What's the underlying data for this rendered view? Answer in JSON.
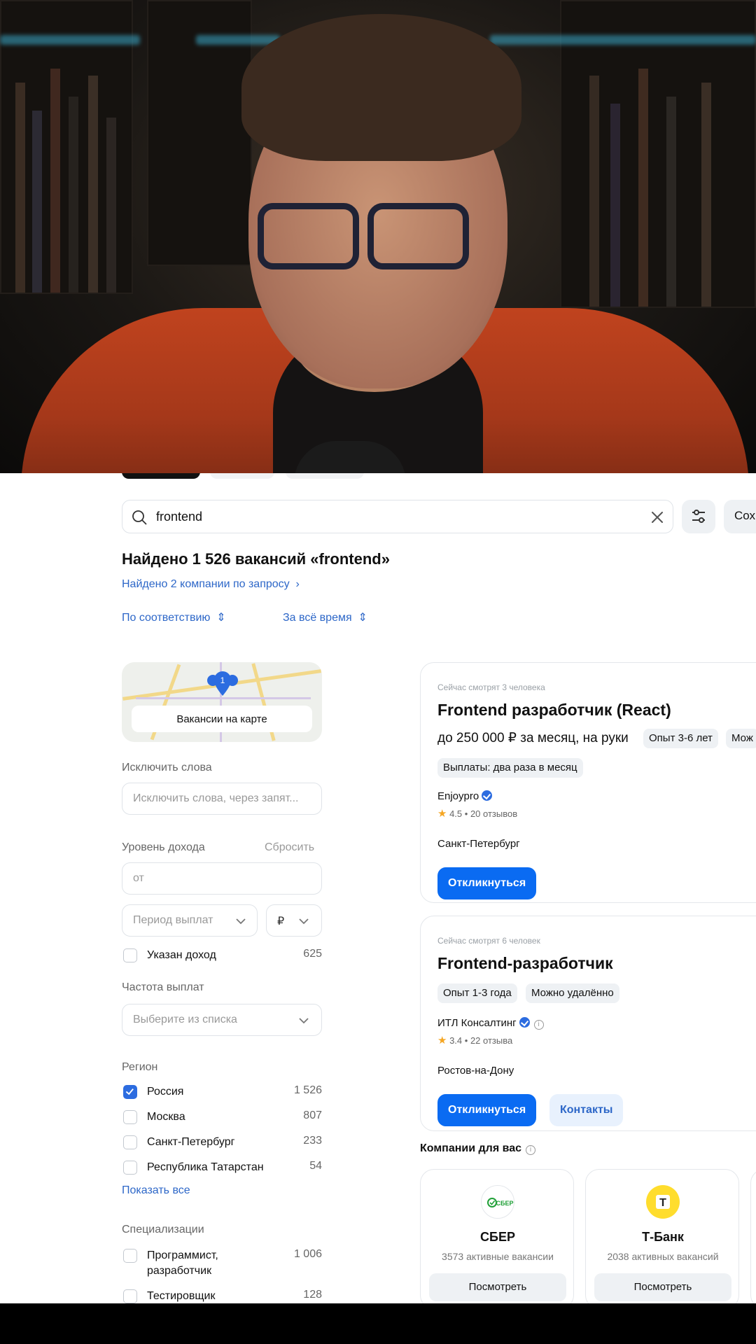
{
  "search": {
    "query": "frontend",
    "save_label": "Сох"
  },
  "results": {
    "title": "Найдено 1 526 вакансий «frontend»",
    "companies_link": "Найдено 2 компании по запросу",
    "sort_relevance": "По соответствию",
    "sort_period": "За всё время"
  },
  "filters": {
    "map_label": "Вакансии на карте",
    "map_pin_count": "1",
    "exclude_label": "Исключить слова",
    "exclude_placeholder": "Исключить слова, через запят...",
    "income_label": "Уровень дохода",
    "income_reset": "Сбросить",
    "income_from_placeholder": "от",
    "period_placeholder": "Период выплат",
    "currency": "₽",
    "income_specified": {
      "label": "Указан доход",
      "count": "625"
    },
    "frequency_label": "Частота выплат",
    "frequency_placeholder": "Выберите из списка",
    "region_label": "Регион",
    "regions": [
      {
        "label": "Россия",
        "count": "1 526",
        "checked": true
      },
      {
        "label": "Москва",
        "count": "807",
        "checked": false
      },
      {
        "label": "Санкт-Петербург",
        "count": "233",
        "checked": false
      },
      {
        "label": "Республика Татарстан",
        "count": "54",
        "checked": false
      }
    ],
    "show_all": "Показать все",
    "spec_label": "Специализации",
    "specializations": [
      {
        "label_line1": "Программист,",
        "label_line2": "разработчик",
        "count": "1 006"
      },
      {
        "label": "Тестировщик",
        "count": "128"
      }
    ]
  },
  "vacancies": [
    {
      "watching": "Сейчас смотрят 3 человека",
      "title": "Frontend разработчик (React)",
      "salary": "до 250 000 ₽ за месяц, на руки",
      "tags": [
        "Опыт 3-6 лет",
        "Мож",
        "Выплаты: два раза в месяц"
      ],
      "company": "Enjoypro",
      "rating": "4.5",
      "reviews": "20 отзывов",
      "city": "Санкт-Петербург",
      "apply": "Откликнуться"
    },
    {
      "watching": "Сейчас смотрят 6 человек",
      "title": "Frontend-разработчик",
      "tags": [
        "Опыт 1-3 года",
        "Можно удалённо"
      ],
      "company": "ИТЛ Консалтинг",
      "rating": "3.4",
      "reviews": "22 отзыва",
      "city": "Ростов-на-Дону",
      "apply": "Откликнуться",
      "contacts": "Контакты"
    }
  ],
  "companies": {
    "title": "Компании для вас",
    "items": [
      {
        "logo_text": "СБЕР",
        "name": "СБЕР",
        "count": "3573 активные вакансии",
        "button": "Посмотреть"
      },
      {
        "logo_text": "Т",
        "name": "Т-Банк",
        "count": "2038 активных вакансий",
        "button": "Посмотреть"
      }
    ]
  },
  "colors": {
    "primary": "#0a6bf2",
    "link": "#2d67c8",
    "jacket": "#c0431e"
  }
}
